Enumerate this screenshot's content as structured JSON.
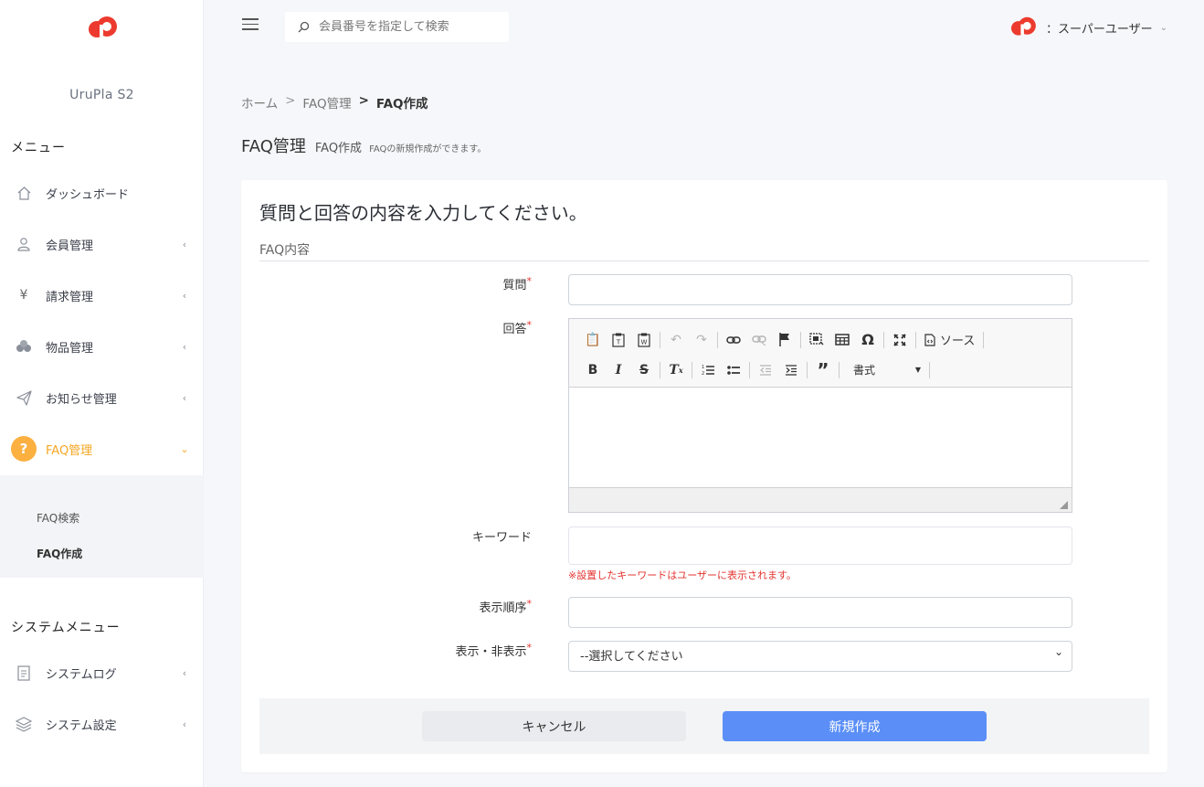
{
  "brand": {
    "app_name": "UruPla S2",
    "logo_color": "#ec3b2e"
  },
  "sidebar": {
    "menu_title": "メニュー",
    "items": [
      {
        "label": "ダッシュボード",
        "icon": "home-icon",
        "chevron": ""
      },
      {
        "label": "会員管理",
        "icon": "user-icon",
        "chevron": "‹"
      },
      {
        "label": "請求管理",
        "icon": "yen-icon",
        "chevron": "‹"
      },
      {
        "label": "物品管理",
        "icon": "boxes-icon",
        "chevron": "‹"
      },
      {
        "label": "お知らせ管理",
        "icon": "paper-plane-icon",
        "chevron": "‹"
      },
      {
        "label": "FAQ管理",
        "icon": "question-icon",
        "chevron": "⌄",
        "active": true,
        "badge": "?"
      }
    ],
    "faq_submenu": [
      {
        "label": "FAQ検索"
      },
      {
        "label": "FAQ作成",
        "current": true
      }
    ],
    "system_menu_title": "システムメニュー",
    "system_items": [
      {
        "label": "システムログ",
        "icon": "document-icon",
        "chevron": "‹"
      },
      {
        "label": "システム設定",
        "icon": "layers-icon",
        "chevron": "‹"
      }
    ],
    "accent_color": "#f5a623"
  },
  "header": {
    "search_placeholder": "会員番号を指定して検索",
    "user_name": "：スーパーユーザー",
    "user_chevron": "⌄"
  },
  "breadcrumb": {
    "home": "ホーム",
    "parent": "FAQ管理",
    "current": "FAQ作成",
    "sep1": ">",
    "sep2": ">"
  },
  "page": {
    "title": "FAQ管理",
    "subtitle": "FAQ作成",
    "description": "FAQの新規作成ができます。"
  },
  "form": {
    "heading": "質問と回答の内容を入力してください。",
    "section_label": "FAQ内容",
    "required_mark": "*",
    "question": {
      "label": "質問",
      "value": ""
    },
    "answer": {
      "label": "回答",
      "source_label": "ソース",
      "format_label": "書式"
    },
    "keyword": {
      "label": "キーワード",
      "value": "",
      "hint": "※設置したキーワードはユーザーに表示されます。"
    },
    "order": {
      "label": "表示順序",
      "value": ""
    },
    "visibility": {
      "label": "表示・非表示",
      "selected": "--選択してください"
    },
    "cancel_label": "キャンセル",
    "submit_label": "新規作成",
    "submit_color": "#5b8ff7"
  }
}
